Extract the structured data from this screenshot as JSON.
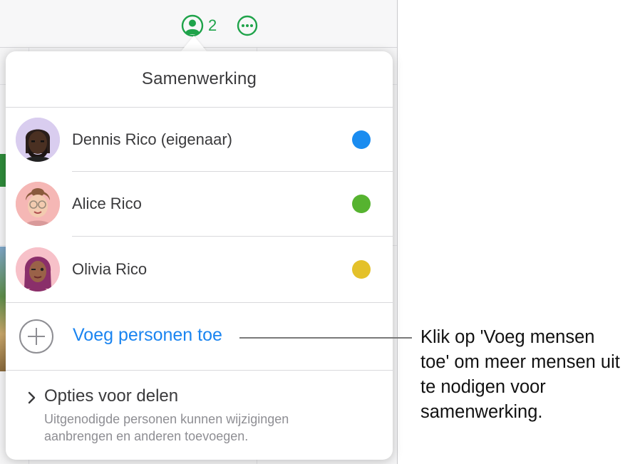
{
  "toolbar": {
    "collaborator_count": "2",
    "collab_icon": "person-circle-icon",
    "more_icon": "ellipsis-circle-icon",
    "accent_color": "#1fa34a"
  },
  "popover": {
    "title": "Samenwerking",
    "participants": [
      {
        "name": "Dennis Rico (eigenaar)",
        "avatar": "memoji-dennis",
        "color": "#1a8cf0"
      },
      {
        "name": "Alice Rico",
        "avatar": "memoji-alice",
        "color": "#56b330"
      },
      {
        "name": "Olivia Rico",
        "avatar": "memoji-olivia",
        "color": "#e4c12a"
      }
    ],
    "add_people": {
      "label": "Voeg personen toe",
      "icon": "plus-circle-icon",
      "color": "#1a84f0"
    },
    "sharing_options": {
      "title": "Opties voor delen",
      "subtitle": "Uitgenodigde personen kunnen wijzigingen aanbrengen en anderen toevoegen.",
      "icon": "chevron-right-icon"
    }
  },
  "callout": {
    "text": "Klik op 'Voeg mensen toe' om meer mensen uit te nodigen voor samenwerking."
  }
}
